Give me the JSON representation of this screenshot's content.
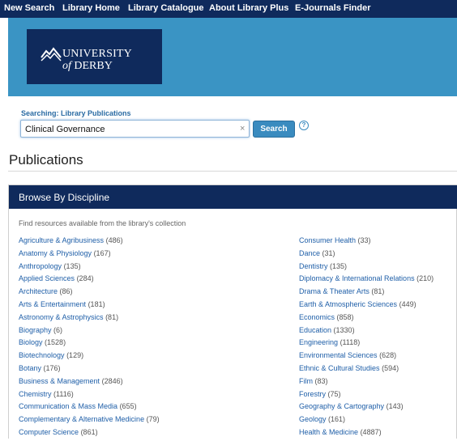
{
  "nav": {
    "items": [
      "New Search",
      "Library Home",
      "Library Catalogue",
      "About Library Plus",
      "E-Journals Finder"
    ]
  },
  "logo": {
    "line1": "UNIVERSITY",
    "line2_of": "of",
    "line2_name": "DERBY"
  },
  "search": {
    "label": "Searching: Library Publications",
    "value": "Clinical Governance",
    "clear": "×",
    "button": "Search",
    "help": "?"
  },
  "page": {
    "title": "Publications"
  },
  "browse": {
    "heading": "Browse By Discipline",
    "description": "Find resources available from the library's collection",
    "left": [
      {
        "name": "Agriculture & Agribusiness",
        "count": "(486)"
      },
      {
        "name": "Anatomy & Physiology",
        "count": "(167)"
      },
      {
        "name": "Anthropology",
        "count": "(135)"
      },
      {
        "name": "Applied Sciences",
        "count": "(284)"
      },
      {
        "name": "Architecture",
        "count": "(86)"
      },
      {
        "name": "Arts & Entertainment",
        "count": "(181)"
      },
      {
        "name": "Astronomy & Astrophysics",
        "count": "(81)"
      },
      {
        "name": "Biography",
        "count": "(6)"
      },
      {
        "name": "Biology",
        "count": "(1528)"
      },
      {
        "name": "Biotechnology",
        "count": "(129)"
      },
      {
        "name": "Botany",
        "count": "(176)"
      },
      {
        "name": "Business & Management",
        "count": "(2846)"
      },
      {
        "name": "Chemistry",
        "count": "(1116)"
      },
      {
        "name": "Communication & Mass Media",
        "count": "(655)"
      },
      {
        "name": "Complementary & Alternative Medicine",
        "count": "(79)"
      },
      {
        "name": "Computer Science",
        "count": "(861)"
      }
    ],
    "right": [
      {
        "name": "Consumer Health",
        "count": "(33)"
      },
      {
        "name": "Dance",
        "count": "(31)"
      },
      {
        "name": "Dentistry",
        "count": "(135)"
      },
      {
        "name": "Diplomacy & International Relations",
        "count": "(210)"
      },
      {
        "name": "Drama & Theater Arts",
        "count": "(81)"
      },
      {
        "name": "Earth & Atmospheric Sciences",
        "count": "(449)"
      },
      {
        "name": "Economics",
        "count": "(858)"
      },
      {
        "name": "Education",
        "count": "(1330)"
      },
      {
        "name": "Engineering",
        "count": "(1118)"
      },
      {
        "name": "Environmental Sciences",
        "count": "(628)"
      },
      {
        "name": "Ethnic & Cultural Studies",
        "count": "(594)"
      },
      {
        "name": "Film",
        "count": "(83)"
      },
      {
        "name": "Forestry",
        "count": "(75)"
      },
      {
        "name": "Geography & Cartography",
        "count": "(143)"
      },
      {
        "name": "Geology",
        "count": "(161)"
      },
      {
        "name": "Health & Medicine",
        "count": "(4887)"
      }
    ]
  },
  "colors": {
    "navy": "#0f2a5c",
    "banner": "#3a94c4",
    "link": "#1f5fa8",
    "button": "#3a8bbf"
  }
}
